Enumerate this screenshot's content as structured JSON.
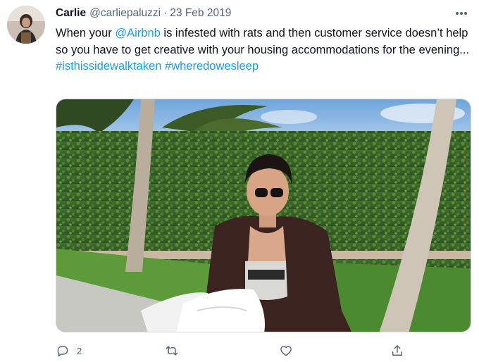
{
  "tweet": {
    "author_name": "Carlie",
    "handle": "@carliepaluzzi",
    "separator": "·",
    "date": "23 Feb 2019",
    "text_before_mention": "When your ",
    "mention": "@Airbnb",
    "text_after_mention": " is infested with rats and then customer service doesn’t help so you have to get creative with your housing accommodations for the evening...",
    "hashtag_1": "#isthissidewalktaken",
    "hashtag_2": "#wheredowesleep"
  },
  "actions": {
    "reply_count": "2"
  },
  "colors": {
    "link": "#1d9bf0",
    "secondary_text": "#536471",
    "primary_text": "#0f1419"
  },
  "icons": [
    "more-icon",
    "reply-icon",
    "retweet-icon",
    "like-icon",
    "share-icon"
  ]
}
